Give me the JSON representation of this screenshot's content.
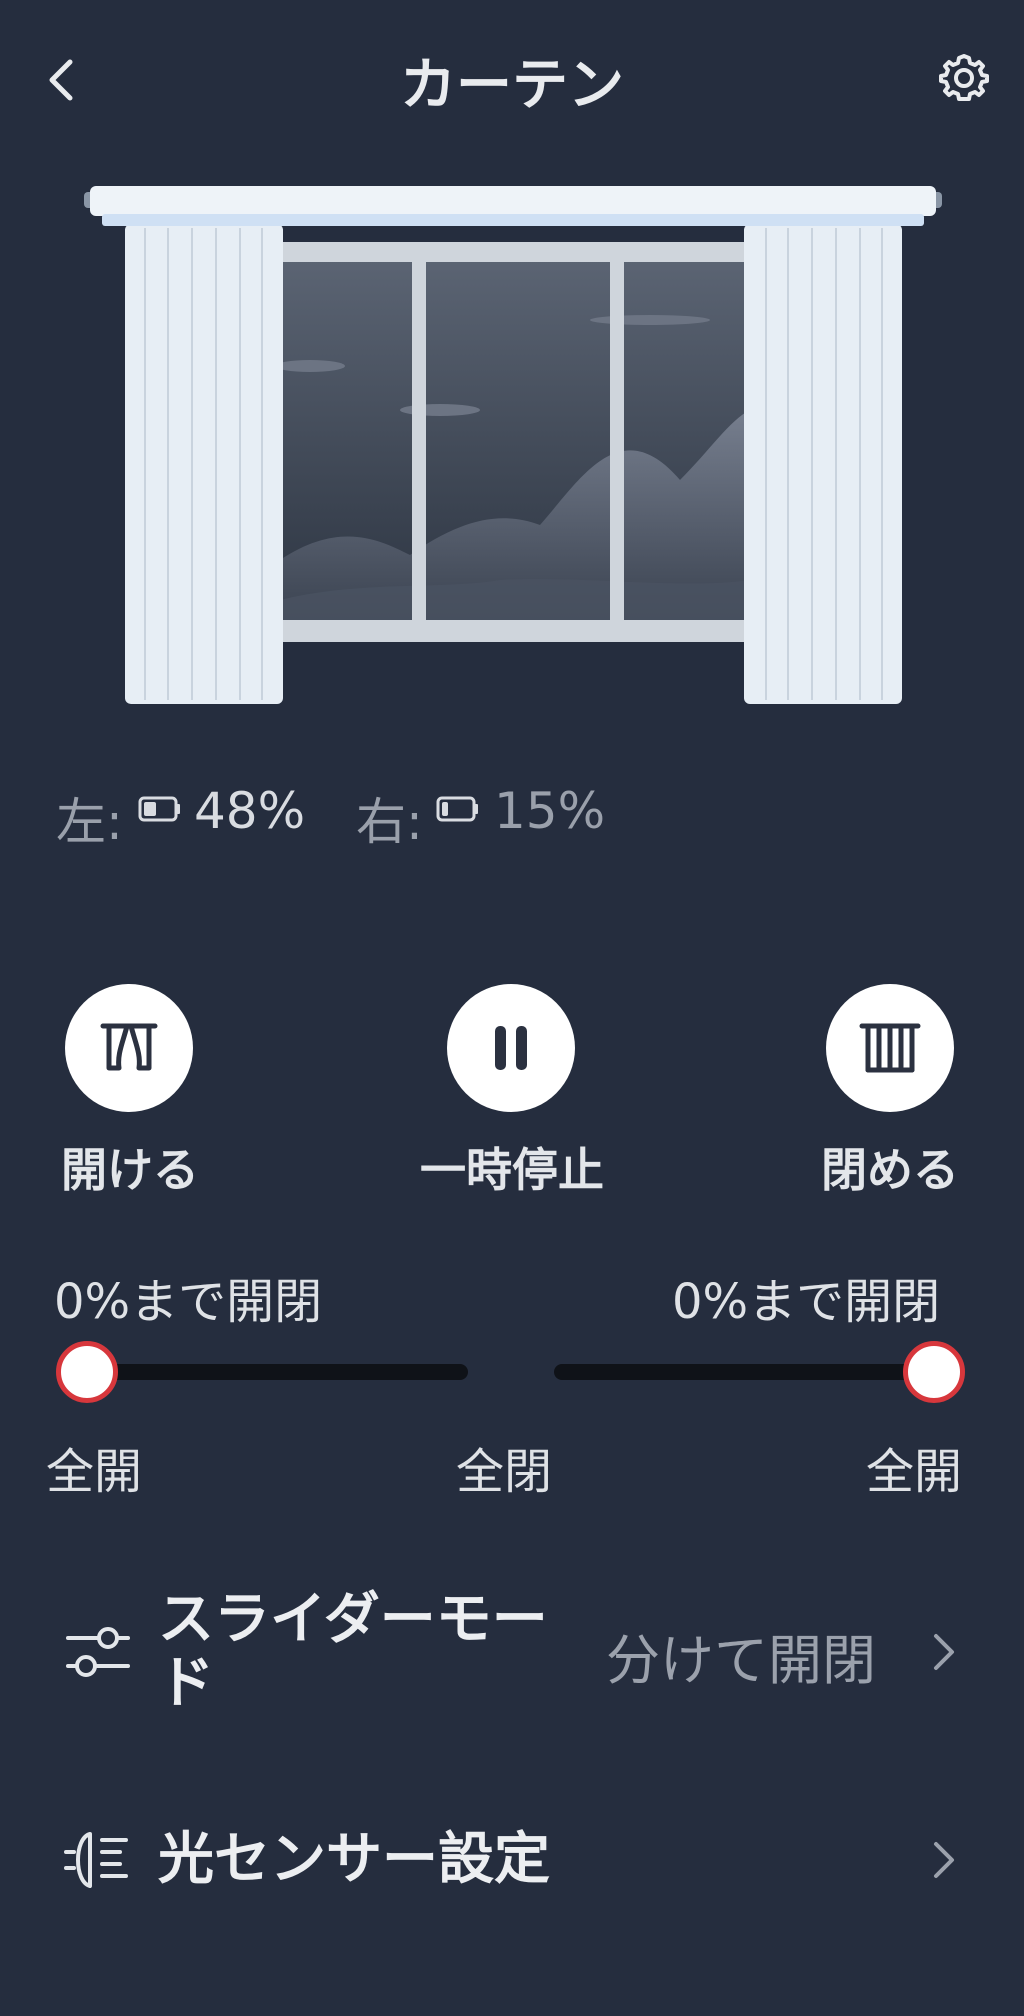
{
  "header": {
    "title": "カーテン"
  },
  "battery": {
    "left_label": "左:",
    "left_value": "48%",
    "right_label": "右:",
    "right_value": "15%"
  },
  "controls": {
    "open_label": "開ける",
    "pause_label": "一時停止",
    "close_label": "閉める"
  },
  "sliders": {
    "left": {
      "label": "0%まで開閉",
      "value_percent": 0
    },
    "right": {
      "label": "0%まで開閉",
      "value_percent": 0
    },
    "left_min_label": "全開",
    "center_label": "全閉",
    "right_max_label": "全開"
  },
  "settings": {
    "slider_mode": {
      "title": "スライダーモード",
      "value": "分けて開閉"
    },
    "light_sensor": {
      "title": "光センサー設定"
    }
  },
  "colors": {
    "background": "#252d3e",
    "accent": "#d7373c",
    "track": "#0f1218"
  },
  "icons": [
    "back-arrow-icon",
    "gear-icon",
    "battery-icon",
    "curtain-open-icon",
    "pause-icon",
    "curtain-close-icon",
    "slider-mode-icon",
    "light-sensor-icon",
    "chevron-right-icon"
  ]
}
